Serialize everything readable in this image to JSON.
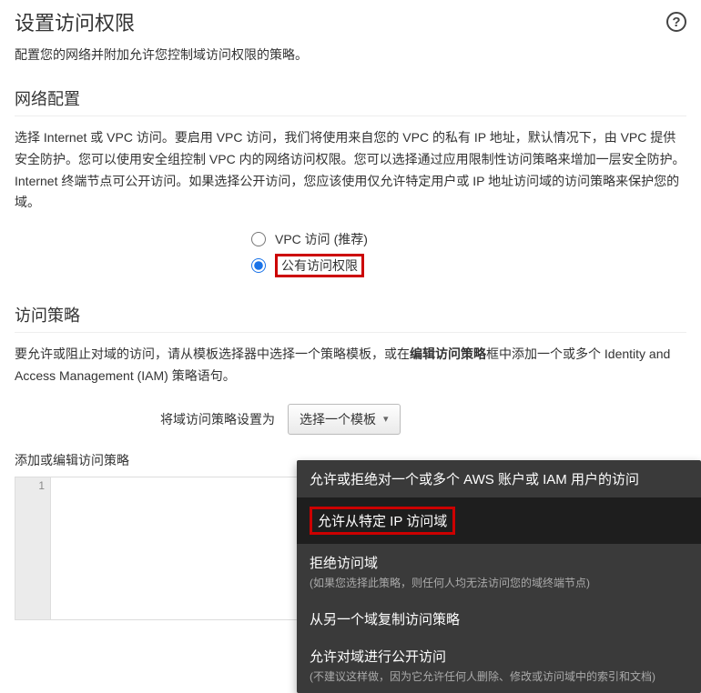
{
  "header": {
    "title": "设置访问权限",
    "help_icon": "?"
  },
  "subtitle": "配置您的网络并附加允许您控制域访问权限的策略。",
  "network": {
    "heading": "网络配置",
    "desc": "选择 Internet 或 VPC 访问。要启用 VPC 访问，我们将使用来自您的 VPC 的私有 IP 地址，默认情况下，由 VPC 提供安全防护。您可以使用安全组控制 VPC 内的网络访问权限。您可以选择通过应用限制性访问策略来增加一层安全防护。Internet 终端节点可公开访问。如果选择公开访问，您应该使用仅允许特定用户或 IP 地址访问域的访问策略来保护您的域。",
    "radio_vpc": "VPC 访问 (推荐)",
    "radio_public": "公有访问权限"
  },
  "policy": {
    "heading": "访问策略",
    "desc_prefix": "要允许或阻止对域的访问，请从模板选择器中选择一个策略模板，或在",
    "desc_bold": "编辑访问策略",
    "desc_suffix": "框中添加一个或多个 Identity and Access Management (IAM) 策略语句。",
    "set_label": "将域访问策略设置为",
    "select_button": "选择一个模板",
    "dropdown": {
      "opt1_title": "允许或拒绝对一个或多个 AWS 账户或 IAM 用户的访问",
      "opt2_title": "允许从特定 IP 访问域",
      "opt3_title": "拒绝访问域",
      "opt3_desc": "(如果您选择此策略，则任何人均无法访问您的域终端节点)",
      "opt4_title": "从另一个域复制访问策略",
      "opt5_title": "允许对域进行公开访问",
      "opt5_desc": "(不建议这样做，因为它允许任何人删除、修改或访问域中的索引和文档)"
    }
  },
  "editor": {
    "label": "添加或编辑访问策略",
    "line1": "1"
  }
}
